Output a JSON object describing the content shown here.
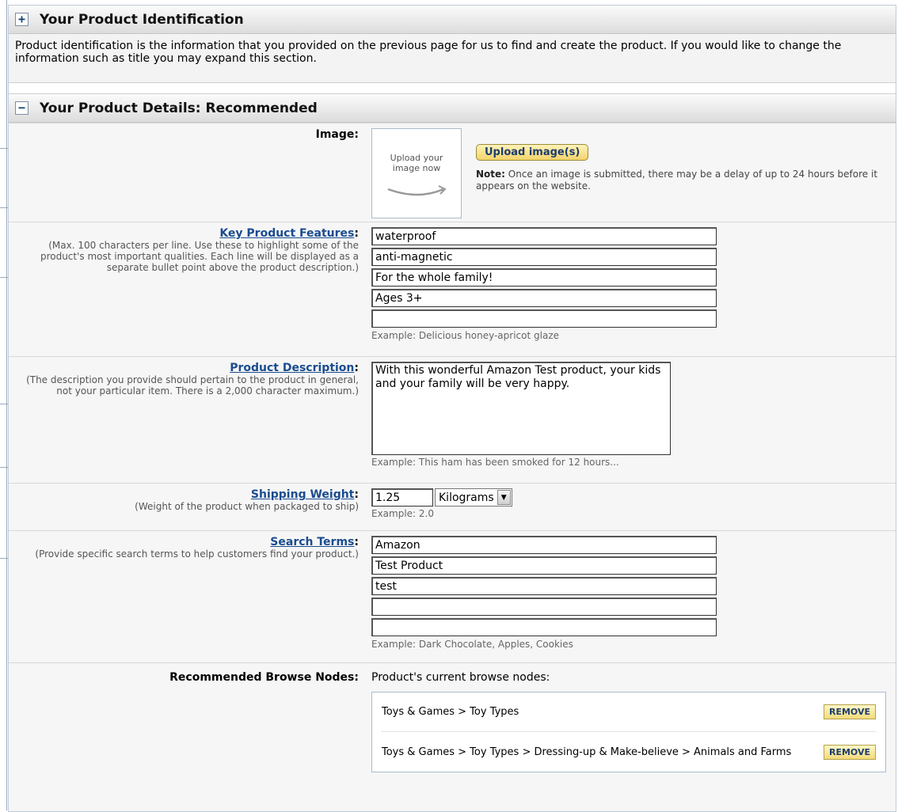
{
  "identification": {
    "toggle": "+",
    "title": "Your Product Identification",
    "text": "Product identification is the information that you provided on the previous page for us to find and create the product. If you would like to change the information such as title you may expand this section."
  },
  "details": {
    "toggle": "−",
    "title": "Your Product Details: Recommended"
  },
  "image": {
    "label": "Image",
    "placeholder_text": "Upload your image now",
    "button": "Upload image(s)",
    "note_label": "Note:",
    "note_text": " Once an image is submitted, there may be a delay of up to 24 hours before it appears on the website."
  },
  "features": {
    "label": "Key Product Features",
    "help": "(Max. 100 characters per line. Use these to highlight some of the product's most important qualities. Each line will be displayed as a separate bullet point above the product description.)",
    "values": [
      "waterproof",
      "anti-magnetic",
      "For the whole family!",
      "Ages 3+",
      ""
    ],
    "example": "Example: Delicious honey-apricot glaze"
  },
  "description": {
    "label": "Product Description",
    "help": "(The description you provide should pertain to the product in general, not your particular item. There is a 2,000 character maximum.)",
    "value": "With this wonderful Amazon Test product, your kids and your family will be very happy.",
    "example": "Example: This ham has been smoked for 12 hours..."
  },
  "shipping": {
    "label": "Shipping Weight",
    "help": "(Weight of the product when packaged to ship)",
    "value": "1.25",
    "unit": "Kilograms",
    "example": "Example: 2.0"
  },
  "search": {
    "label": "Search Terms",
    "help": "(Provide specific search terms to help customers find your product.)",
    "values": [
      "Amazon",
      "Test Product",
      "test",
      "",
      ""
    ],
    "example": "Example: Dark Chocolate, Apples, Cookies"
  },
  "browse": {
    "label": "Recommended Browse Nodes",
    "heading": "Product's current browse nodes:",
    "nodes": [
      "Toys & Games > Toy Types",
      "Toys & Games > Toy Types > Dressing-up & Make-believe > Animals and Farms"
    ],
    "remove_label": "REMOVE"
  },
  "colon": ":"
}
